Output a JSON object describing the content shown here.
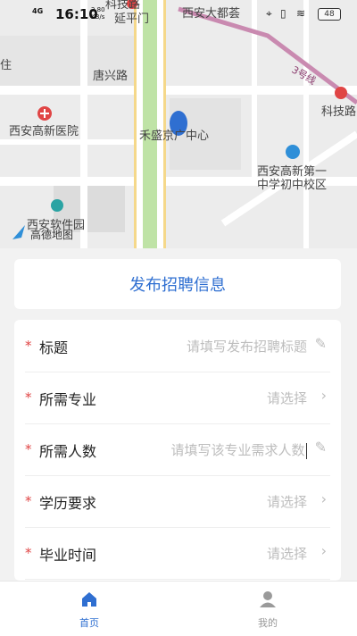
{
  "status_bar": {
    "network": "4G",
    "time": "16:10",
    "speed_value": "2.80",
    "speed_unit": "KB/s",
    "battery": "48"
  },
  "map": {
    "labels": {
      "keji_road_top": "科技路",
      "yanpingmen": "延平门",
      "xian_dadu": "西安大都荟",
      "zhu": "住",
      "line3": "3号线",
      "tangxing_road": "唐兴路",
      "keji_road": "科技路",
      "gaoxin_hospital": "西安高新医院",
      "hesheng": "禾盛京广中心",
      "school_line1": "西安高新第一",
      "school_line2": "中学初中校区",
      "software_park": "西安软件园",
      "amap_logo": "高德地图"
    }
  },
  "header": {
    "title": "发布招聘信息"
  },
  "form": {
    "rows": [
      {
        "label": "标题",
        "placeholder": "请填写发布招聘标题",
        "trail": "edit"
      },
      {
        "label": "所需专业",
        "placeholder": "请选择",
        "trail": "chevron"
      },
      {
        "label": "所需人数",
        "placeholder": "请填写该专业需求人数",
        "trail": "edit"
      },
      {
        "label": "学历要求",
        "placeholder": "请选择",
        "trail": "chevron"
      },
      {
        "label": "毕业时间",
        "placeholder": "请选择",
        "trail": "chevron"
      }
    ]
  },
  "tabbar": {
    "home_label": "首页",
    "mine_label": "我的",
    "active_color": "#2f6fd1",
    "inactive_color": "#999999"
  }
}
